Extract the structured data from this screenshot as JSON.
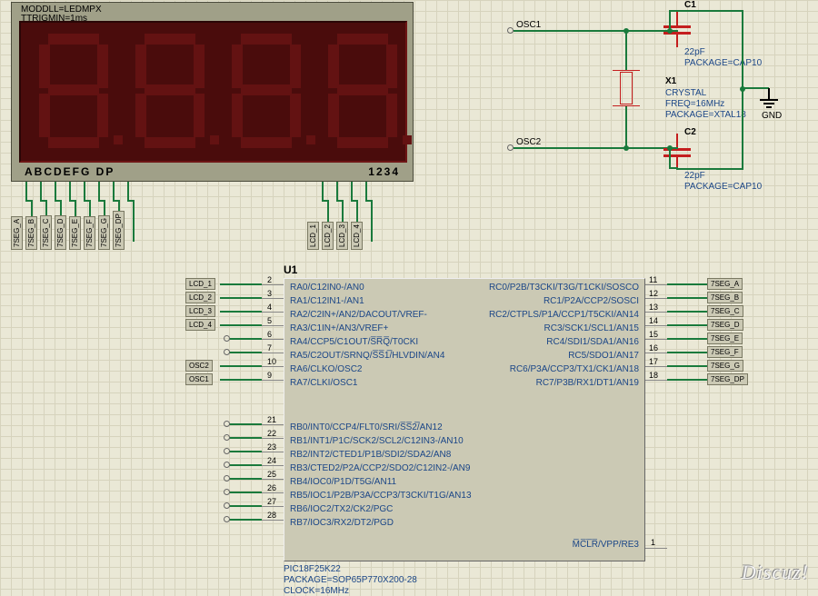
{
  "display": {
    "top_label1": "MODDLL=LEDMPX",
    "top_label2": "TTRIGMIN=1ms",
    "legend_left": "ABCDEFG  DP",
    "legend_right": "1234",
    "seg_nets": [
      "7SEG_A",
      "7SEG_B",
      "7SEG_C",
      "7SEG_D",
      "7SEG_E",
      "7SEG_F",
      "7SEG_G",
      "7SEG_DP"
    ],
    "digit_nets": [
      "LCD_1",
      "LCD_2",
      "LCD_3",
      "LCD_4"
    ]
  },
  "ic": {
    "ref": "U1",
    "left_a": [
      {
        "num": "2",
        "name": "RA0/C12IN0-/AN0",
        "net": "LCD_1"
      },
      {
        "num": "3",
        "name": "RA1/C12IN1-/AN1",
        "net": "LCD_2"
      },
      {
        "num": "4",
        "name": "RA2/C2IN+/AN2/DACOUT/VREF-",
        "net": "LCD_3"
      },
      {
        "num": "5",
        "name": "RA3/C1IN+/AN3/VREF+",
        "net": "LCD_4"
      },
      {
        "num": "6",
        "name": "RA4/CCP5/C1OUT/S̅R̅Q̅/T0CKI",
        "net": ""
      },
      {
        "num": "7",
        "name": "RA5/C2OUT/SRNQ/S̅S̅1̅/HLVDIN/AN4",
        "net": ""
      },
      {
        "num": "10",
        "name": "RA6/CLKO/OSC2",
        "net": "OSC2"
      },
      {
        "num": "9",
        "name": "RA7/CLKI/OSC1",
        "net": "OSC1"
      }
    ],
    "left_b": [
      {
        "num": "21",
        "name": "RB0/INT0/CCP4/FLT0/SRI/S̅S̅2̅/AN12"
      },
      {
        "num": "22",
        "name": "RB1/INT1/P1C/SCK2/SCL2/C12IN3-/AN10"
      },
      {
        "num": "23",
        "name": "RB2/INT2/CTED1/P1B/SDI2/SDA2/AN8"
      },
      {
        "num": "24",
        "name": "RB3/CTED2/P2A/CCP2/SDO2/C12IN2-/AN9"
      },
      {
        "num": "25",
        "name": "RB4/IOC0/P1D/T5G/AN11"
      },
      {
        "num": "26",
        "name": "RB5/IOC1/P2B/P3A/CCP3/T3CKI/T1G/AN13"
      },
      {
        "num": "27",
        "name": "RB6/IOC2/TX2/CK2/PGC"
      },
      {
        "num": "28",
        "name": "RB7/IOC3/RX2/DT2/PGD"
      }
    ],
    "right": [
      {
        "num": "11",
        "name": "RC0/P2B/T3CKI/T3G/T1CKI/SOSCO",
        "net": "7SEG_A"
      },
      {
        "num": "12",
        "name": "RC1/P2A/CCP2/SOSCI",
        "net": "7SEG_B"
      },
      {
        "num": "13",
        "name": "RC2/CTPLS/P1A/CCP1/T5CKI/AN14",
        "net": "7SEG_C"
      },
      {
        "num": "14",
        "name": "RC3/SCK1/SCL1/AN15",
        "net": "7SEG_D"
      },
      {
        "num": "15",
        "name": "RC4/SDI1/SDA1/AN16",
        "net": "7SEG_E"
      },
      {
        "num": "16",
        "name": "RC5/SDO1/AN17",
        "net": "7SEG_F"
      },
      {
        "num": "17",
        "name": "RC6/P3A/CCP3/TX1/CK1/AN18",
        "net": "7SEG_G"
      },
      {
        "num": "18",
        "name": "RC7/P3B/RX1/DT1/AN19",
        "net": "7SEG_DP"
      }
    ],
    "mclr": {
      "num": "1",
      "name": "M̅C̅L̅R̅/VPP/RE3"
    },
    "footer": [
      "PIC18F25K22",
      "PACKAGE=SOP65P770X200-28",
      "CLOCK=16MHz"
    ]
  },
  "osc": {
    "net1": "OSC1",
    "net2": "OSC2",
    "c1": {
      "ref": "C1",
      "value": "22pF",
      "pkg": "PACKAGE=CAP10"
    },
    "c2": {
      "ref": "C2",
      "value": "22pF",
      "pkg": "PACKAGE=CAP10"
    },
    "xtal": {
      "ref": "X1",
      "type": "CRYSTAL",
      "freq": "FREQ=16MHz",
      "pkg": "PACKAGE=XTAL18"
    },
    "gnd": "GND"
  },
  "watermark": "Discuz!"
}
